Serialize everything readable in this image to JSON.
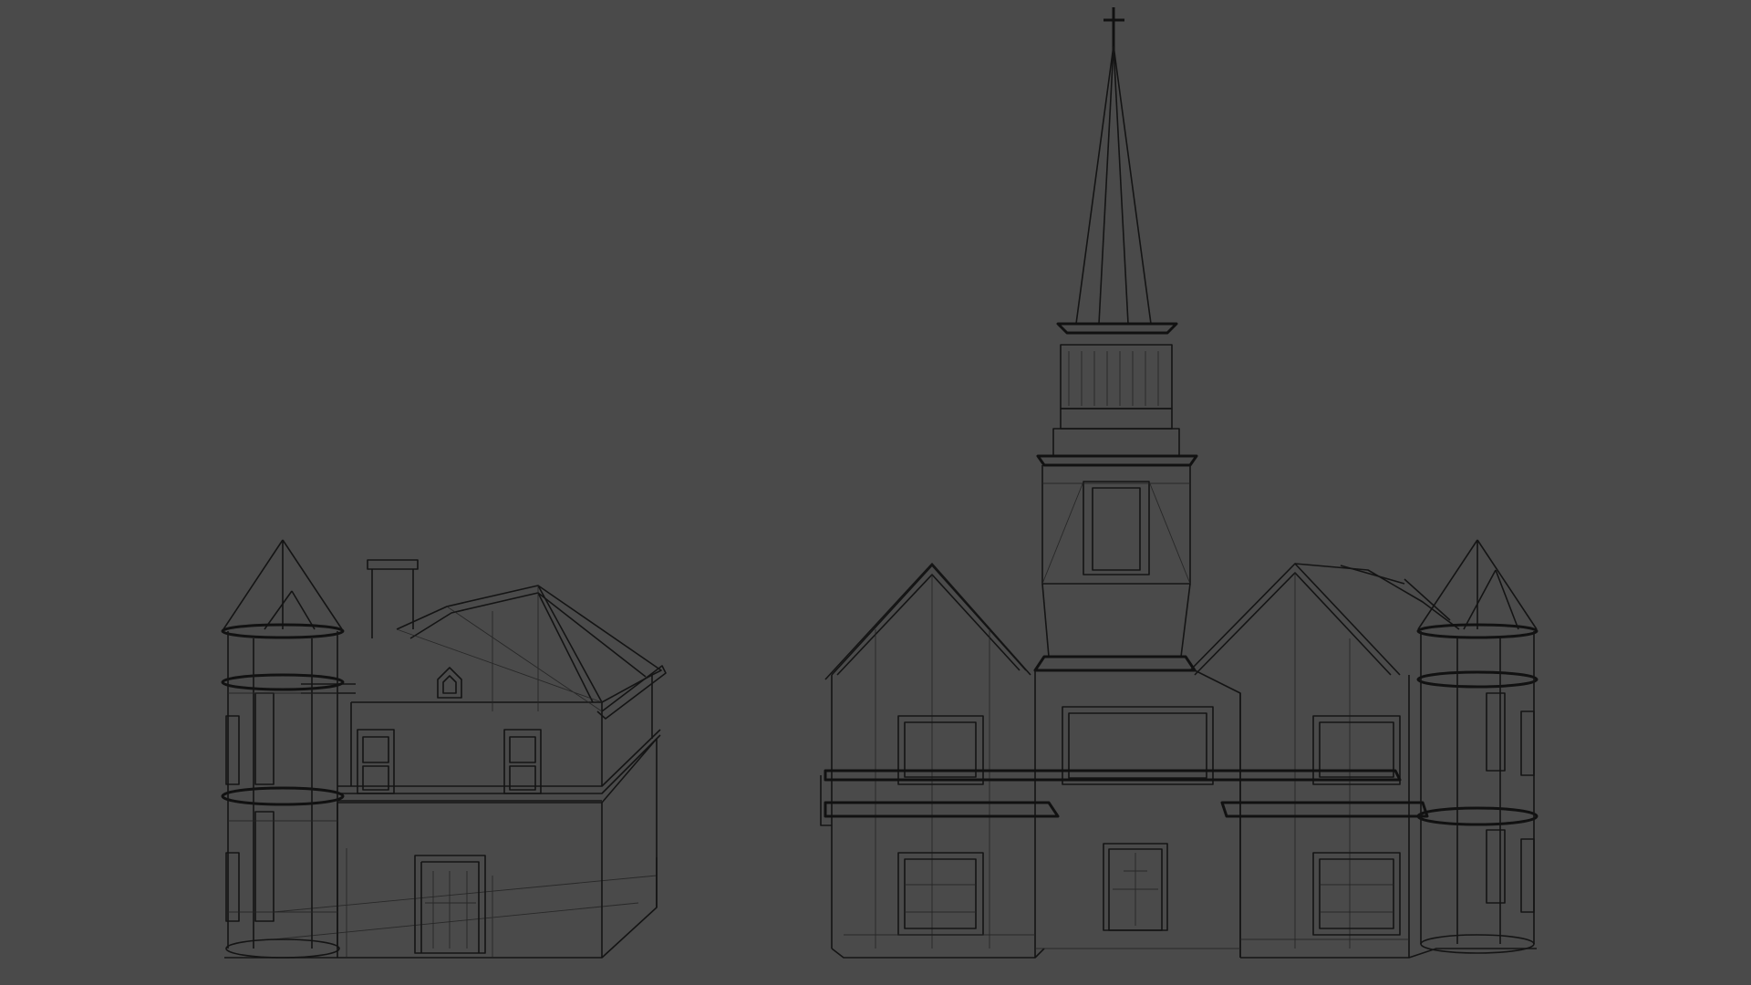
{
  "viewport": {
    "background": "#4a4a4a",
    "wire_color": "#141414",
    "render_mode": "wireframe"
  },
  "models": [
    {
      "id": "house",
      "kind": "victorian-house"
    },
    {
      "id": "church",
      "kind": "church-with-steeple"
    }
  ]
}
